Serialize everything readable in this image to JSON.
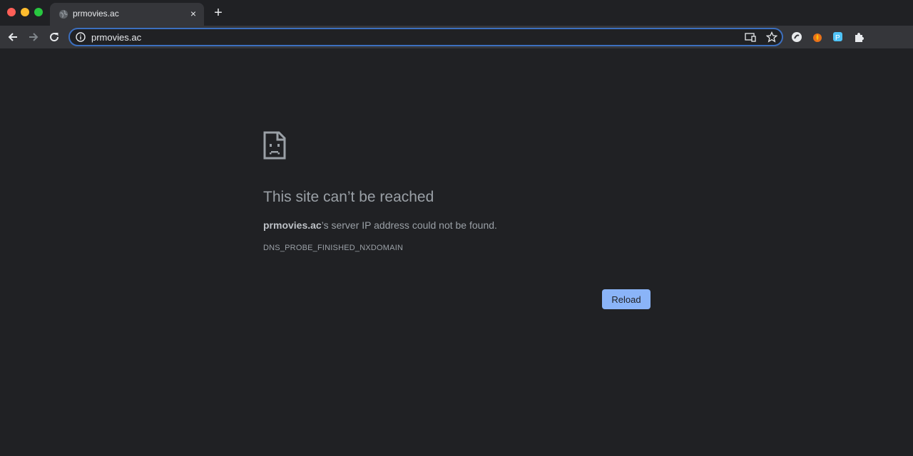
{
  "tab": {
    "title": "prmovies.ac",
    "close_glyph": "×",
    "icon": "globe-icon"
  },
  "newtab": {
    "glyph": "+"
  },
  "toolbar": {
    "url": "prmovies.ac",
    "extension_badge": "0"
  },
  "page": {
    "headline": "This site can’t be reached",
    "host": "prmovies.ac",
    "message_suffix": "’s server IP address could not be found.",
    "error_code": "DNS_PROBE_FINISHED_NXDOMAIN",
    "reload_label": "Reload",
    "icon": "sad-page-icon"
  },
  "colors": {
    "accent": "#8ab4f8",
    "background": "#202124",
    "toolbar": "#35363a"
  }
}
